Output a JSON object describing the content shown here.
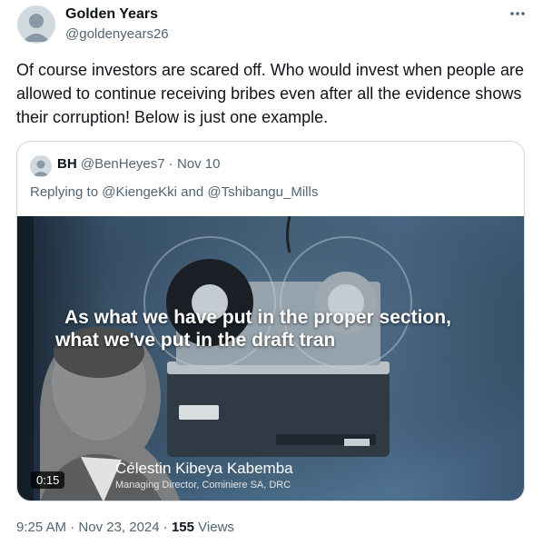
{
  "post": {
    "display_name": "Golden Years",
    "handle": "@goldenyears26",
    "more_icon": "more-horizontal-icon",
    "text": "Of course investors are scared off. Who would invest when people are allowed to continue receiving bribes even after all the evidence shows their corruption! Below is just one example.",
    "time": "9:25 AM",
    "date": "Nov 23, 2024",
    "separator": "·",
    "views_count": "155",
    "views_label": "Views"
  },
  "quoted_post": {
    "name": "BH",
    "handle": "@BenHeyes7",
    "separator": "·",
    "date": "Nov 10",
    "replying_prefix": "Replying to",
    "mention_1": "@KiengeKki",
    "and_word": "and",
    "mention_2": "@Tshibangu_Mills",
    "video": {
      "caption_line_1": "As what we have put in the proper section,",
      "caption_line_2": "what we've put in the draft tran",
      "lower_third_name": "Célestin Kibeya Kabemba",
      "lower_third_title": "Managing Director, Cominiere SA, DRC",
      "duration": "0:15"
    }
  }
}
